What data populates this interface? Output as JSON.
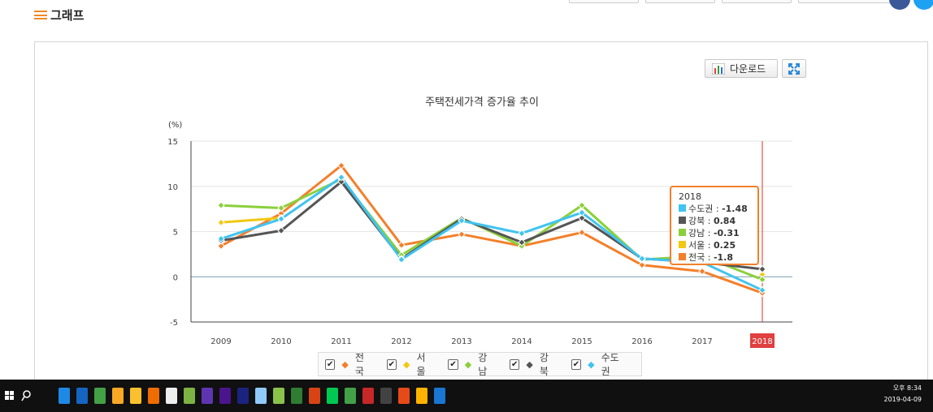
{
  "header": {
    "title": "그래프"
  },
  "toolbar": {
    "download_label": "다운로드"
  },
  "chart_data": {
    "type": "line",
    "title": "주택전세가격 증가율 추이",
    "ylabel": "(%)",
    "categories": [
      "2009",
      "2010",
      "2011",
      "2012",
      "2013",
      "2014",
      "2015",
      "2016",
      "2017",
      "2018"
    ],
    "ylim": [
      -5,
      15
    ],
    "yticks": [
      15,
      10,
      5,
      0,
      -5
    ],
    "series": [
      {
        "name": "전국",
        "color": "#f47f2a",
        "values": [
          3.4,
          7.0,
          12.3,
          3.5,
          4.7,
          3.4,
          4.9,
          1.3,
          0.6,
          -1.8
        ]
      },
      {
        "name": "서울",
        "color": "#f2c811",
        "values": [
          6.0,
          6.5,
          null,
          null,
          null,
          null,
          null,
          null,
          null,
          0.25
        ]
      },
      {
        "name": "강남",
        "color": "#8bd03a",
        "values": [
          7.9,
          7.6,
          10.8,
          2.4,
          6.5,
          3.4,
          7.9,
          1.9,
          2.3,
          -0.31
        ]
      },
      {
        "name": "강북",
        "color": "#555555",
        "values": [
          4.0,
          5.1,
          10.5,
          2.0,
          6.4,
          3.8,
          6.5,
          2.0,
          1.6,
          0.84
        ]
      },
      {
        "name": "수도권",
        "color": "#40c4f0",
        "values": [
          4.2,
          6.4,
          11.0,
          1.9,
          6.2,
          4.8,
          7.1,
          2.0,
          1.6,
          -1.48
        ]
      }
    ],
    "highlight_category": "2018",
    "tooltip": {
      "title": "2018",
      "rows": [
        {
          "name": "수도권",
          "value": "-1.48",
          "color": "#40c4f0"
        },
        {
          "name": "강북",
          "value": "0.84",
          "color": "#555555"
        },
        {
          "name": "강남",
          "value": "-0.31",
          "color": "#8bd03a"
        },
        {
          "name": "서울",
          "value": "0.25",
          "color": "#f2c811"
        },
        {
          "name": "전국",
          "value": "-1.8",
          "color": "#f47f2a"
        }
      ]
    },
    "legend_position": "bottom"
  },
  "taskbar": {
    "time": "오후 8:34",
    "date": "2019-04-09"
  }
}
